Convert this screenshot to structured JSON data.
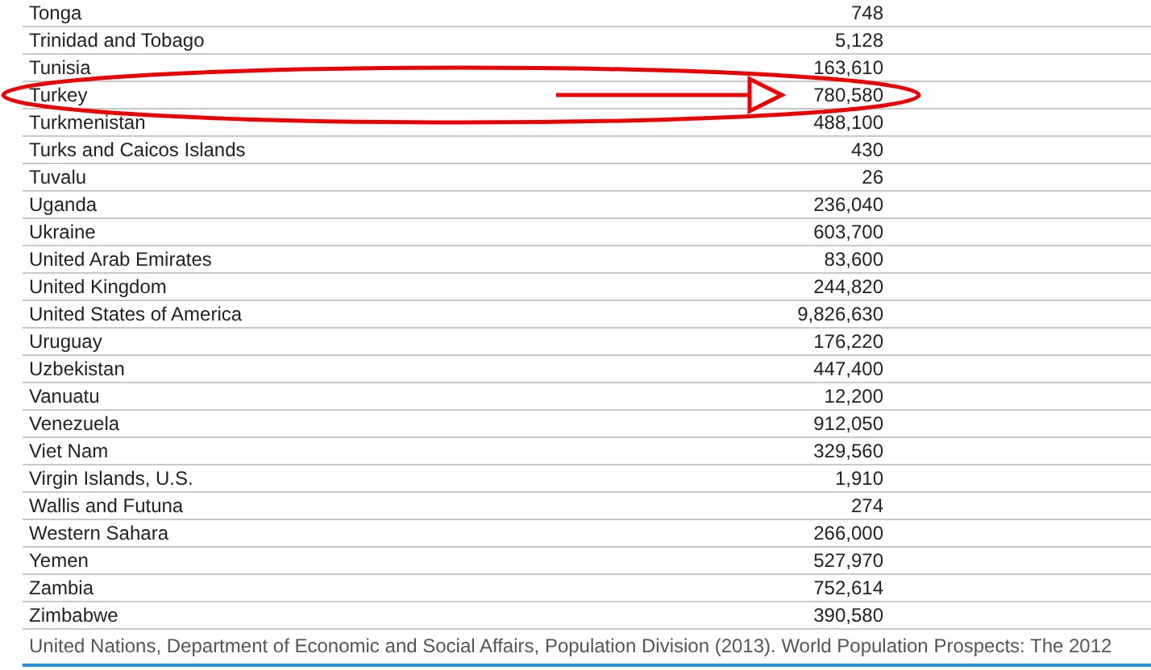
{
  "table": {
    "rows": [
      {
        "country": "Tonga",
        "value": "748",
        "highlighted": false
      },
      {
        "country": "Trinidad and Tobago",
        "value": "5,128",
        "highlighted": false
      },
      {
        "country": "Tunisia",
        "value": "163,610",
        "highlighted": false
      },
      {
        "country": "Turkey",
        "value": "780,580",
        "highlighted": true
      },
      {
        "country": "Turkmenistan",
        "value": "488,100",
        "highlighted": false
      },
      {
        "country": "Turks and Caicos Islands",
        "value": "430",
        "highlighted": false
      },
      {
        "country": "Tuvalu",
        "value": "26",
        "highlighted": false
      },
      {
        "country": "Uganda",
        "value": "236,040",
        "highlighted": false
      },
      {
        "country": "Ukraine",
        "value": "603,700",
        "highlighted": false
      },
      {
        "country": "United Arab Emirates",
        "value": "83,600",
        "highlighted": false
      },
      {
        "country": "United Kingdom",
        "value": "244,820",
        "highlighted": false
      },
      {
        "country": "United States of America",
        "value": "9,826,630",
        "highlighted": false
      },
      {
        "country": "Uruguay",
        "value": "176,220",
        "highlighted": false
      },
      {
        "country": "Uzbekistan",
        "value": "447,400",
        "highlighted": false
      },
      {
        "country": "Vanuatu",
        "value": "12,200",
        "highlighted": false
      },
      {
        "country": "Venezuela",
        "value": "912,050",
        "highlighted": false
      },
      {
        "country": "Viet Nam",
        "value": "329,560",
        "highlighted": false
      },
      {
        "country": "Virgin Islands, U.S.",
        "value": "1,910",
        "highlighted": false
      },
      {
        "country": "Wallis and Futuna",
        "value": "274",
        "highlighted": false
      },
      {
        "country": "Western Sahara",
        "value": "266,000",
        "highlighted": false
      },
      {
        "country": "Yemen",
        "value": "527,970",
        "highlighted": false
      },
      {
        "country": "Zambia",
        "value": "752,614",
        "highlighted": false
      },
      {
        "country": "Zimbabwe",
        "value": "390,580",
        "highlighted": false
      }
    ]
  },
  "source_note": "United Nations, Department of Economic and Social Affairs, Population Division (2013). World Population Prospects: The 2012"
}
